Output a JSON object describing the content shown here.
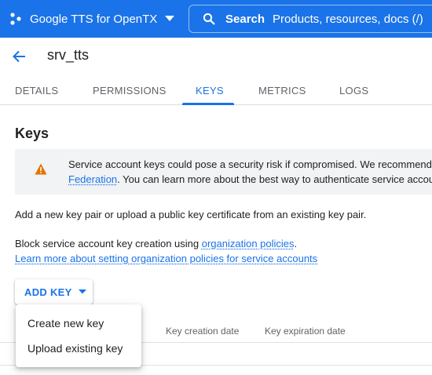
{
  "topbar": {
    "project_name": "Google TTS for OpenTX",
    "search_label": "Search",
    "search_hint": "Products, resources, docs (/)"
  },
  "page": {
    "title": "srv_tts"
  },
  "tabs": [
    {
      "label": "DETAILS"
    },
    {
      "label": "PERMISSIONS"
    },
    {
      "label": "KEYS",
      "active": true
    },
    {
      "label": "METRICS"
    },
    {
      "label": "LOGS"
    }
  ],
  "keys_section": {
    "title": "Keys",
    "alert": {
      "line1": "Service account keys could pose a security risk if compromised. We recommend",
      "link": "Federation",
      "line2_rest": ". You can learn more about the best way to authenticate service accou"
    },
    "intro": "Add a new key pair or upload a public key certificate from an existing key pair.",
    "policy_prefix": "Block service account key creation using ",
    "policy_link": "organization policies",
    "policy_suffix": ".",
    "learn_more_link": "Learn more about setting organization policies for service accounts",
    "add_key_label": "ADD KEY"
  },
  "table": {
    "columns": [
      "Key creation date",
      "Key expiration date"
    ]
  },
  "add_key_menu": {
    "items": [
      "Create new key",
      "Upload existing key"
    ]
  },
  "colors": {
    "accent": "#1a73e8",
    "warning": "#e37400"
  },
  "icons": {
    "project": "hexagon-dots-icon",
    "dropdown": "caret-down-icon",
    "search": "search-icon",
    "back": "arrow-back-icon",
    "warning": "warning-icon"
  }
}
